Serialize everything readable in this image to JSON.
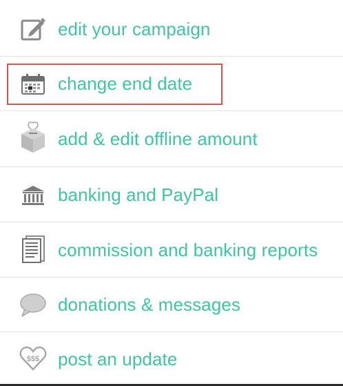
{
  "menu": {
    "items": [
      {
        "label": "edit your campaign",
        "icon": "edit-icon"
      },
      {
        "label": "change end date",
        "icon": "calendar-icon"
      },
      {
        "label": "add & edit offline amount",
        "icon": "donation-box-icon"
      },
      {
        "label": "banking and PayPal",
        "icon": "bank-icon"
      },
      {
        "label": "commission and banking reports",
        "icon": "reports-icon"
      },
      {
        "label": "donations & messages",
        "icon": "speech-bubble-icon"
      },
      {
        "label": "post an update",
        "icon": "heart-money-icon"
      }
    ],
    "highlighted_item": "change end date"
  },
  "colors": {
    "label": "#3cc7a0",
    "icon": "#8a8a8a",
    "divider": "#e2e2e2",
    "highlight": "#d9534f"
  }
}
